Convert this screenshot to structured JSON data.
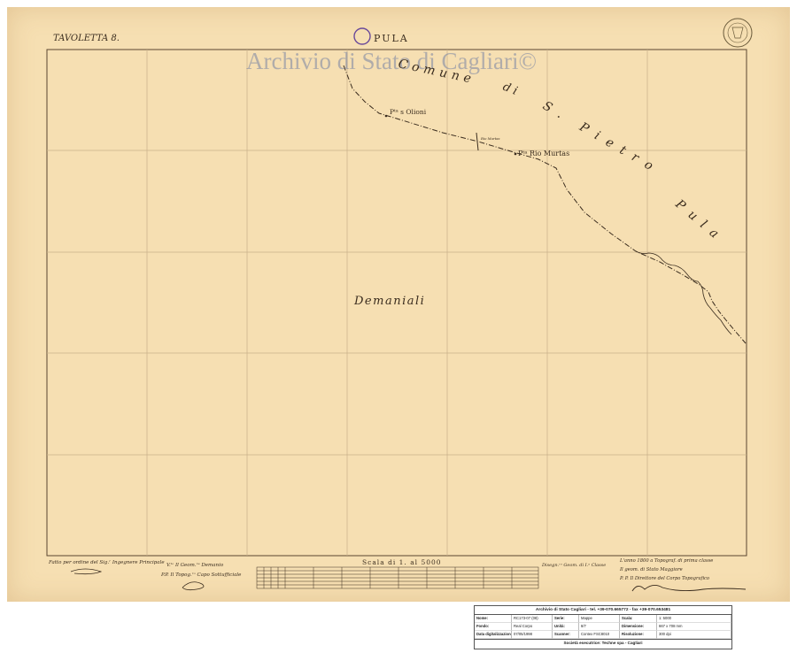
{
  "sheet": {
    "tavoletta": "TAVOLETTA 8.",
    "place_title": "PULA",
    "watermark": "Archivio di Stato di Cagliari©",
    "labels": {
      "comune_word": "Comune",
      "di_word": "di",
      "s_pietro": "S. Pietro",
      "pula": "Pula",
      "point_olioni": "Pᵗᵃ s Olioni",
      "point_rio_murtas": "Pᵗᵃ Rio Murtas",
      "rio_small": "Rio Murtas",
      "demaniali": "Demaniali"
    },
    "scale_caption": "Scala di 1. al 5000",
    "signatures": {
      "left": "Fatto per ordine del Sig.ʳ Ingegnere Principale",
      "center_1": "V.ᵗᵒ Il Geom.ʳᵉ Demanio",
      "center_2": "P.P. Il Topog.ʳᵒ Capo Sottufficiale",
      "scale_note": "Disegn.ʳᵒ Geom. di I.ᵃ Classe",
      "right_1": "L'anno 1800 a Topograf. di prima classe",
      "right_2": "Il geom. di Stato Maggiore",
      "right_3": "P. P. Il Direttore del Corpo Topografico"
    }
  },
  "archive_table": {
    "header": "Archivio di Stato Cagliari - tel. +39-070.665772 - fax +39-070.653481",
    "rows": [
      [
        "Nome:",
        "RC173-07 (08)",
        "Serie:",
        "Mappe",
        "Scala:",
        "1: 5000"
      ],
      [
        "Fondo:",
        "Real Corpo",
        "Unità:",
        "8/7",
        "Dimensione:",
        "667 x 708 mm"
      ],
      [
        "Data digitalizzazione:",
        "07/05/1998",
        "Scanner:",
        "Contex FSC8010",
        "Risoluzione:",
        "300 dpi"
      ]
    ],
    "footer": "Società esecutrice: Techne spa - Cagliari"
  },
  "colors": {
    "paper": "#f6dfb2",
    "ink": "#3a2c1e",
    "grid": "#c9b08a",
    "watermark": "#5a6ea0"
  }
}
